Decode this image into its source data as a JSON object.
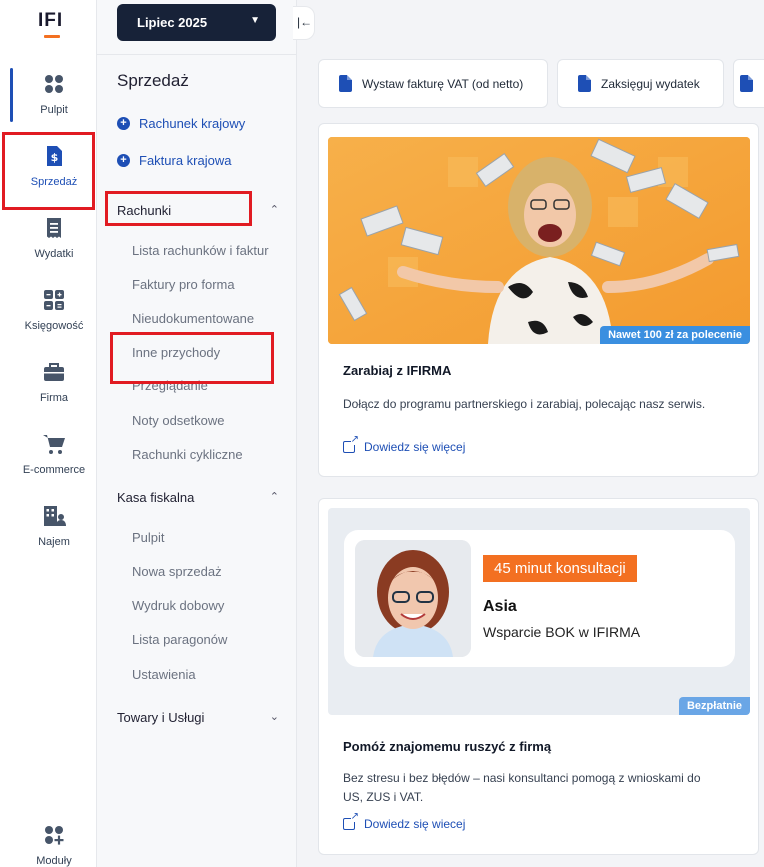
{
  "brand": {
    "logo_text": "IFI",
    "accent": "#f37021",
    "primary": "#1e4fb5",
    "dark": "#172238"
  },
  "rail": {
    "items": [
      {
        "label": "Pulpit",
        "icon": "dashboard-icon"
      },
      {
        "label": "Sprzedaż",
        "icon": "invoice-dollar-icon"
      },
      {
        "label": "Wydatki",
        "icon": "receipt-icon"
      },
      {
        "label": "Księgowość",
        "icon": "calculator-icon"
      },
      {
        "label": "Firma",
        "icon": "briefcase-icon"
      },
      {
        "label": "E-commerce",
        "icon": "cart-icon"
      },
      {
        "label": "Najem",
        "icon": "building-user-icon"
      },
      {
        "label": "Moduły",
        "icon": "modules-plus-icon"
      }
    ]
  },
  "sidebar": {
    "month": "Lipiec 2025",
    "title": "Sprzedaż",
    "links": [
      "Rachunek krajowy",
      "Faktura krajowa"
    ],
    "groups": [
      {
        "label": "Rachunki",
        "items": [
          "Lista rachunków i faktur",
          "Faktury pro forma",
          "Nieudokumentowane",
          "Inne przychody",
          "Przeglądanie",
          "Noty odsetkowe",
          "Rachunki cykliczne"
        ]
      },
      {
        "label": "Kasa fiskalna",
        "items": [
          "Pulpit",
          "Nowa sprzedaż",
          "Wydruk dobowy",
          "Lista paragonów",
          "Ustawienia"
        ]
      },
      {
        "label": "Towary i Usługi",
        "items": []
      }
    ]
  },
  "actions": [
    "Wystaw fakturę VAT (od netto)",
    "Zaksięguj wydatek"
  ],
  "cards": [
    {
      "badge": "Nawet 100 zł za polecenie",
      "title": "Zarabiaj z IFIRMA",
      "desc": "Dołącz do programu partnerskiego i zarabiaj, polecając nasz serwis.",
      "link": "Dowiedz się więcej"
    },
    {
      "tag": "45 minut konsultacji",
      "name": "Asia",
      "role": "Wsparcie BOK w IFIRMA",
      "badge": "Bezpłatnie",
      "title": "Pomóż znajomemu ruszyć z firmą",
      "desc": "Bez stresu i bez błędów – nasi konsultanci pomogą z wnioskami do US, ZUS i VAT.",
      "link": "Dowiedz się wiecej"
    }
  ]
}
